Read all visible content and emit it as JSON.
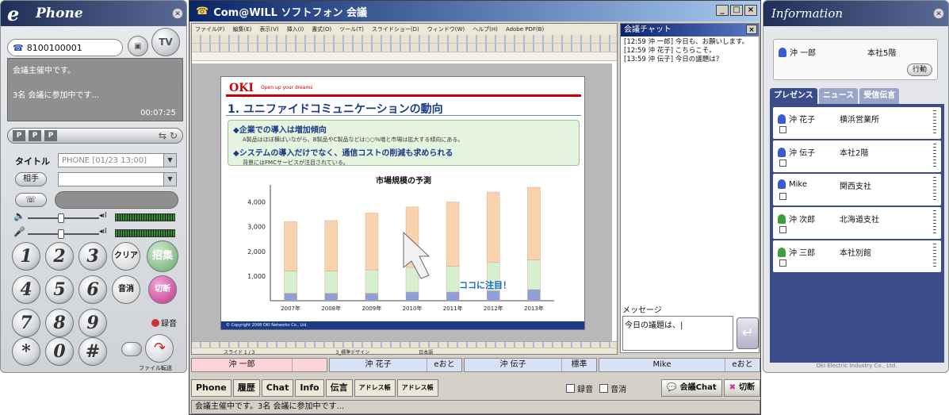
{
  "phone": {
    "title": "Phone",
    "logo": "e",
    "number": "8100100001",
    "tv_label": "TV",
    "screen_lines": [
      "会議主催中です。",
      "3名 会議に参加中です..."
    ],
    "timer": "00:07:25",
    "title_label": "タイトル",
    "title_value": "PHONE [01/23 13:00]",
    "aite_label": "相手",
    "keys": [
      "1",
      "2",
      "3",
      "4",
      "5",
      "6",
      "7",
      "8",
      "9",
      "*",
      "0",
      "#"
    ],
    "clear_label": "クリア",
    "convene_label": "招集",
    "mute_label": "音消",
    "hangup_label": "切断",
    "record_label": "録音",
    "transfer_label": "ファイル転送"
  },
  "conference": {
    "title": "Com@WILL ソフトフォン 会議",
    "ppt_menu": [
      "ファイル(F)",
      "編集(E)",
      "表示(V)",
      "挿入(I)",
      "書式(O)",
      "ツール(T)",
      "スライドショー(D)",
      "ウィンドウ(W)",
      "ヘルプ(H)",
      "Adobe PDF(B)"
    ],
    "slide": {
      "logo": "OKI",
      "tagline": "Open up your dreams",
      "title": "1. ユニファイドコミュニケーションの動向",
      "bullets": [
        {
          "main": "◆企業での導入は増加傾向",
          "sub": "A製品はほぼ横ばいながら、B製品やC製品などは○○%増と市場は拡大する傾向にある。"
        },
        {
          "main": "◆システムの導入だけでなく、通信コストの削減も求められる",
          "sub": "背景にはFMCサービスが注目されている。"
        }
      ],
      "callout": "ココに注目！",
      "footer": "© Copyright 2008 OKI Networks Co., Ltd."
    },
    "ppt_status": [
      "スライド 1 / 3",
      "3_標準デザイン",
      "日本語"
    ],
    "chat": {
      "title": "会議チャット",
      "close": "×",
      "log": [
        "[12:59 沖 一郎] 今日も、お願いします。",
        "[12:59 沖 花子] こちらこそ。",
        "[13:59 沖 伝子] 今日の議題は？"
      ],
      "message_label": "メッセージ",
      "message_value": "今日の議題は、|"
    },
    "participants": [
      {
        "name": "沖 一郎",
        "status": "",
        "color": "#fbd4d4"
      },
      {
        "name": "沖 花子",
        "status": "eおと",
        "color": "#d9e2f5"
      },
      {
        "name": "沖 伝子",
        "status": "標準",
        "color": "#d9e2f5"
      },
      {
        "name": "Mike",
        "status": "eおと",
        "color": "#d9e2f5"
      }
    ],
    "tabs": [
      "Phone",
      "履歴",
      "Chat",
      "Info",
      "伝言",
      "アドレス帳",
      "アドレス帳"
    ],
    "record_check": "録音",
    "mute_check": "音消",
    "chat_button": "会議Chat",
    "disconnect_button": "切断",
    "status_text": "会議主催中です。3名 会議に参加中です..."
  },
  "info": {
    "title": "Information",
    "me_name": "沖 一郎",
    "me_location": "本社5階",
    "action_label": "行動",
    "tabs": [
      "プレゼンス",
      "ニュース",
      "受信伝言"
    ],
    "people": [
      {
        "name": "沖 花子",
        "location": "横浜営業所",
        "status_color": "#3a5bd0"
      },
      {
        "name": "沖 伝子",
        "location": "本社2階",
        "status_color": "#3a5bd0"
      },
      {
        "name": "Mike",
        "location": "関西支社",
        "status_color": "#3a5bd0"
      },
      {
        "name": "沖 次郎",
        "location": "北海道支社",
        "status_color": "#3aa03a"
      },
      {
        "name": "沖 三郎",
        "location": "本社別館",
        "status_color": "#3aa03a"
      }
    ],
    "footer": "Oki Electric Industry Co., Ltd."
  },
  "chart_data": {
    "type": "bar",
    "title": "市場規模の予測",
    "categories": [
      "2007年",
      "2008年",
      "2009年",
      "2010年",
      "2011年",
      "2012年",
      "2013年"
    ],
    "series": [
      {
        "values": [
          300,
          300,
          300,
          350,
          350,
          400,
          450
        ],
        "color": "#8fa0d8"
      },
      {
        "values": [
          900,
          900,
          950,
          1000,
          1050,
          1150,
          1200
        ],
        "color": "#d6efcf"
      },
      {
        "values": [
          2000,
          2050,
          2300,
          2450,
          2600,
          2850,
          2950
        ],
        "color": "#f9d3b0"
      }
    ],
    "yticks": [
      "1,000",
      "2,000",
      "3,000",
      "4,000"
    ],
    "ylim": [
      0,
      4500
    ],
    "stacked": true
  }
}
